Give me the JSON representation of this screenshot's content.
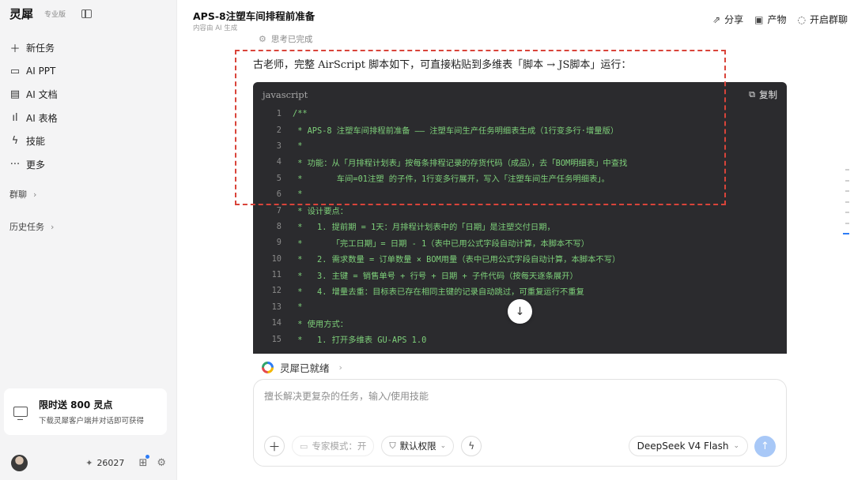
{
  "sidebar": {
    "brand": "灵犀",
    "edition": "专业版",
    "nav": [
      {
        "label": "新任务",
        "icon": "plus-icon"
      },
      {
        "label": "AI PPT",
        "icon": "presentation-icon"
      },
      {
        "label": "AI 文档",
        "icon": "document-icon"
      },
      {
        "label": "AI 表格",
        "icon": "chart-icon"
      },
      {
        "label": "技能",
        "icon": "lightning-icon"
      },
      {
        "label": "更多",
        "icon": "more-icon"
      }
    ],
    "group_chat": "群聊",
    "history": "历史任务",
    "promo": {
      "title": "限时送 800 灵点",
      "subtitle": "下载灵犀客户端并对话即可获得"
    },
    "points": "26027"
  },
  "header": {
    "title": "APS-8注塑车间排程前准备",
    "subtitle": "内容由 AI 生成",
    "actions": [
      {
        "label": "分享",
        "icon": "share-icon"
      },
      {
        "label": "产物",
        "icon": "archive-icon"
      },
      {
        "label": "开启群聊",
        "icon": "chat-bubble-icon"
      }
    ]
  },
  "chat": {
    "thinking_status": "思考已完成",
    "answer_intro": "古老师，完整 AirScript 脚本如下，可直接粘贴到多维表「脚本 → JS脚本」运行：",
    "code": {
      "language": "javascript",
      "copy_label": "复制",
      "lines": [
        {
          "n": "1",
          "text": "/**"
        },
        {
          "n": "2",
          "text": " * APS-8 注塑车间排程前准备 —— 注塑车间生产任务明细表生成（1行变多行·增量版）"
        },
        {
          "n": "3",
          "text": " *"
        },
        {
          "n": "4",
          "text": " * 功能：从「月排程计划表」按每条排程记录的存货代码（成品），去「BOM明细表」中查找"
        },
        {
          "n": "5",
          "text": " *       车间=01注塑 的子件，1行变多行展开，写入「注塑车间生产任务明细表」。"
        },
        {
          "n": "6",
          "text": " *"
        },
        {
          "n": "7",
          "text": " * 设计要点："
        },
        {
          "n": "8",
          "text": " *   1. 提前期 = 1天：月排程计划表中的「日期」是注塑交付日期，"
        },
        {
          "n": "9",
          "text": " *      「完工日期」= 日期 - 1（表中已用公式字段自动计算，本脚本不写）"
        },
        {
          "n": "10",
          "text": " *   2. 需求数量 = 订单数量 × BOM用量（表中已用公式字段自动计算，本脚本不写）"
        },
        {
          "n": "11",
          "text": " *   3. 主键 = 销售单号 + 行号 + 日期 + 子件代码（按每天逐条展开）"
        },
        {
          "n": "12",
          "text": " *   4. 增量去重：目标表已存在相同主键的记录自动跳过，可重复运行不重复"
        },
        {
          "n": "13",
          "text": " *"
        },
        {
          "n": "14",
          "text": " * 使用方式："
        },
        {
          "n": "15",
          "text": " *   1. 打开多维表 GU-APS 1.0"
        }
      ]
    }
  },
  "status_bar": {
    "label": "灵犀已就绪"
  },
  "composer": {
    "placeholder": "擅长解决更复杂的任务，输入/使用技能",
    "expert_mode": "专家模式：开",
    "permission": "默认权限",
    "model": "DeepSeek V4 Flash"
  },
  "colors": {
    "accent": "#2d7cf6",
    "highlight_border": "#d9443a",
    "code_bg": "#2b2b2e",
    "code_text": "#7ed07a"
  }
}
